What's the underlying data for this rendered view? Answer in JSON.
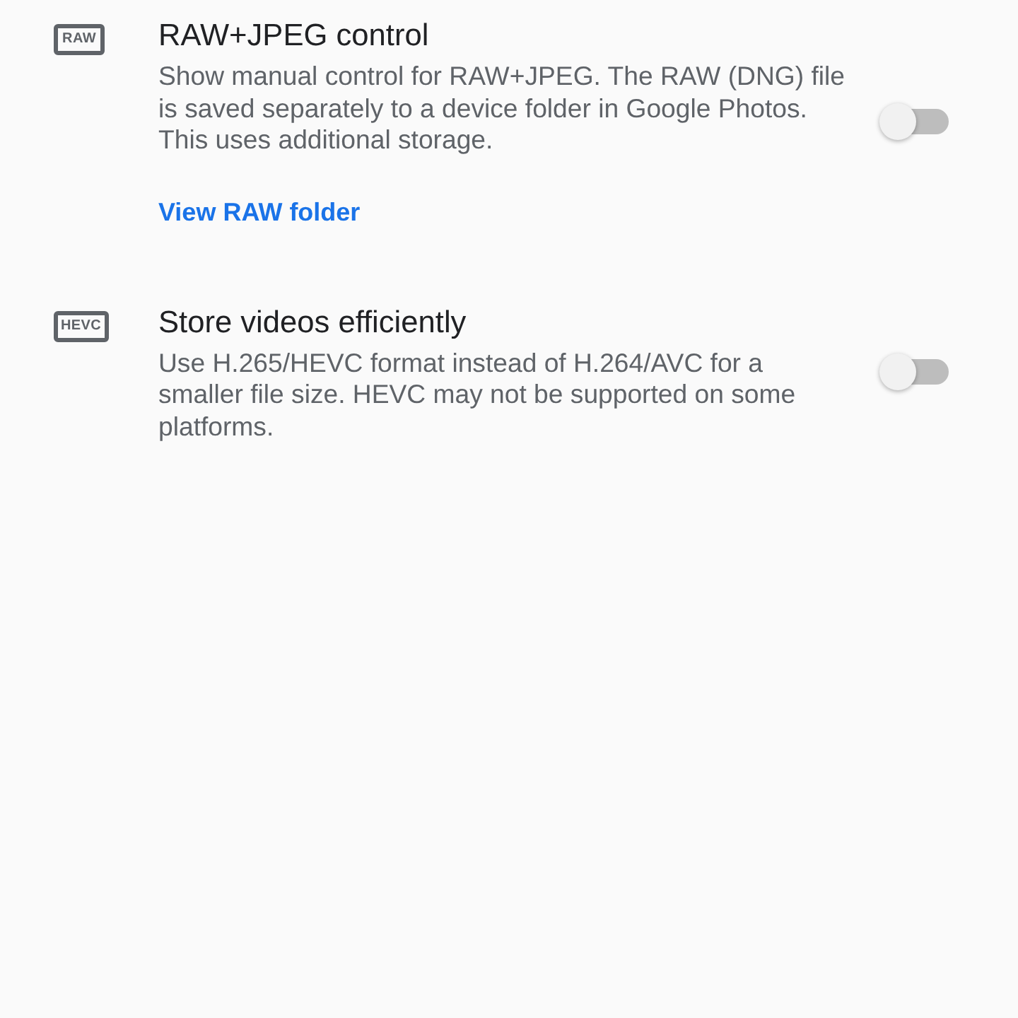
{
  "settings": [
    {
      "icon_label": "RAW",
      "title": "RAW+JPEG control",
      "description": "Show manual control for RAW+JPEG. The RAW (DNG) file is saved separately to a device folder in Google Photos. This uses additional storage.",
      "on": false,
      "link": "View RAW folder"
    },
    {
      "icon_label": "HEVC",
      "title": "Store videos efficiently",
      "description": "Use H.265/HEVC format instead of H.264/AVC for a smaller file size. HEVC may not be supported on some platforms.",
      "on": false
    }
  ]
}
